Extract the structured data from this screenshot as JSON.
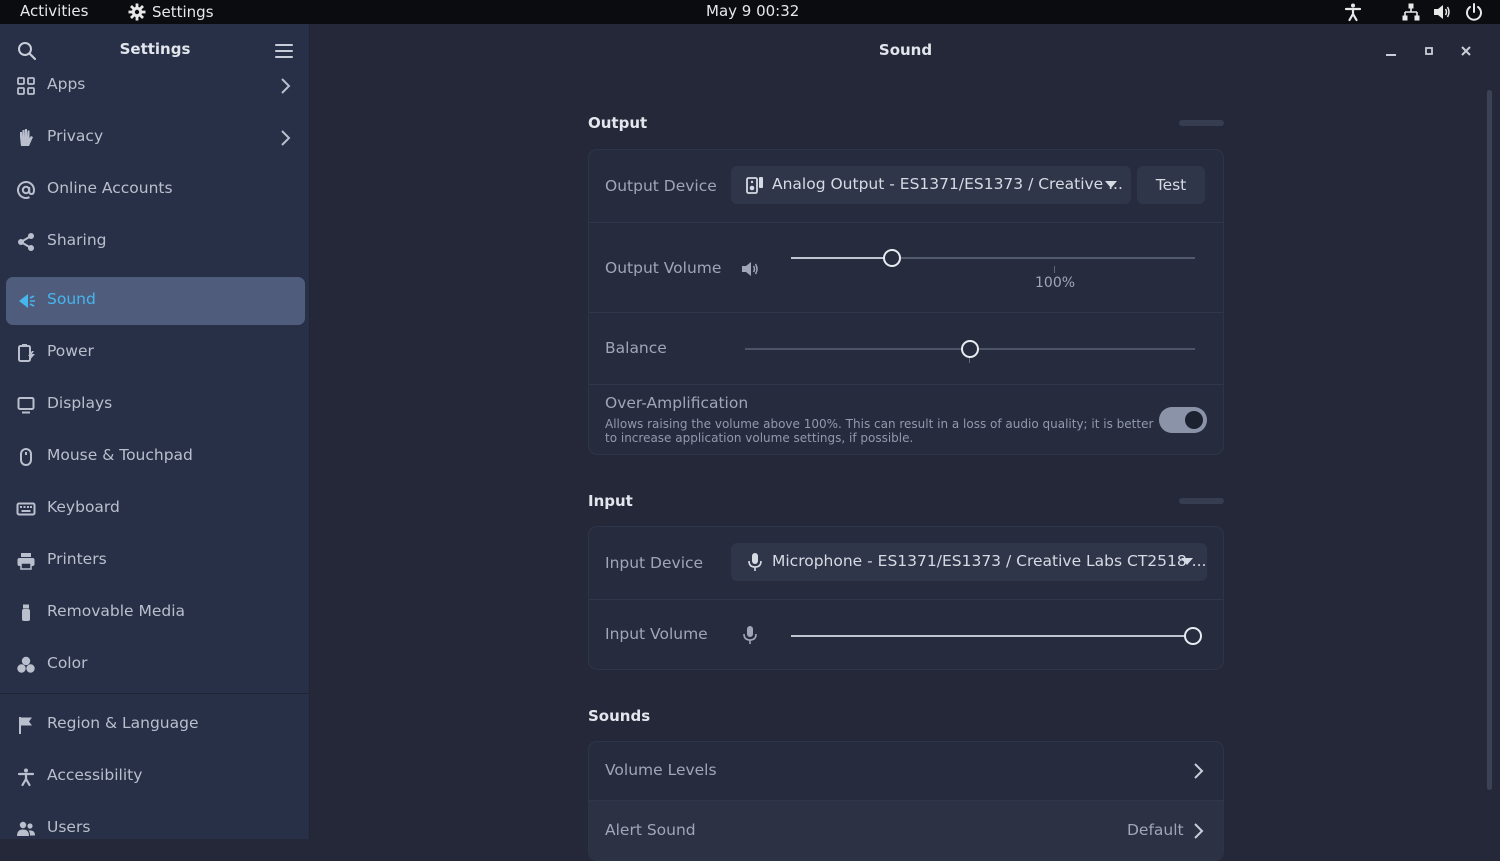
{
  "topbar": {
    "activities": "Activities",
    "app_name": "Settings",
    "clock": "May 9  00:32",
    "status_icons": [
      "accessibility-icon",
      "network-icon",
      "volume-icon",
      "power-icon"
    ]
  },
  "sidebar": {
    "title": "Settings",
    "items": [
      {
        "label": "Apps",
        "icon": "apps-icon",
        "chevron": true
      },
      {
        "label": "Privacy",
        "icon": "hand-icon",
        "chevron": true
      },
      {
        "label": "Online Accounts",
        "icon": "at-icon"
      },
      {
        "label": "Sharing",
        "icon": "share-icon"
      },
      {
        "label": "Sound",
        "icon": "speaker-icon",
        "active": true
      },
      {
        "label": "Power",
        "icon": "battery-icon"
      },
      {
        "label": "Displays",
        "icon": "monitor-icon"
      },
      {
        "label": "Mouse & Touchpad",
        "icon": "mouse-icon"
      },
      {
        "label": "Keyboard",
        "icon": "keyboard-icon"
      },
      {
        "label": "Printers",
        "icon": "printer-icon"
      },
      {
        "label": "Removable Media",
        "icon": "usb-icon"
      },
      {
        "label": "Color",
        "icon": "color-icon"
      },
      {
        "label": "Region & Language",
        "icon": "flag-icon"
      },
      {
        "label": "Accessibility",
        "icon": "accessibility-icon"
      },
      {
        "label": "Users",
        "icon": "users-icon"
      }
    ]
  },
  "window": {
    "title": "Sound",
    "controls": [
      "minimize-icon",
      "maximize-icon",
      "close-icon"
    ]
  },
  "output": {
    "section_title": "Output",
    "device_label": "Output Device",
    "device_value": "Analog Output - ES1371/ES1373 / Creative ...",
    "test_label": "Test",
    "volume_label": "Output Volume",
    "volume_fraction": 0.25,
    "volume_tick_label": "100%",
    "balance_label": "Balance",
    "balance_fraction": 0.5,
    "overamp_label": "Over-Amplification",
    "overamp_desc": "Allows raising the volume above 100%. This can result in a loss of audio quality; it is better to increase application volume settings, if possible.",
    "overamp_enabled": true
  },
  "input": {
    "section_title": "Input",
    "device_label": "Input Device",
    "device_value": "Microphone - ES1371/ES1373 / Creative Labs CT2518 ...",
    "volume_label": "Input Volume",
    "volume_fraction": 1.0
  },
  "sounds": {
    "section_title": "Sounds",
    "volume_levels_label": "Volume Levels",
    "alert_sound_label": "Alert Sound",
    "alert_sound_value": "Default"
  },
  "colors": {
    "accent": "#46b6ee",
    "sidebar_active": "#4f5c7c",
    "background": "#242838"
  }
}
